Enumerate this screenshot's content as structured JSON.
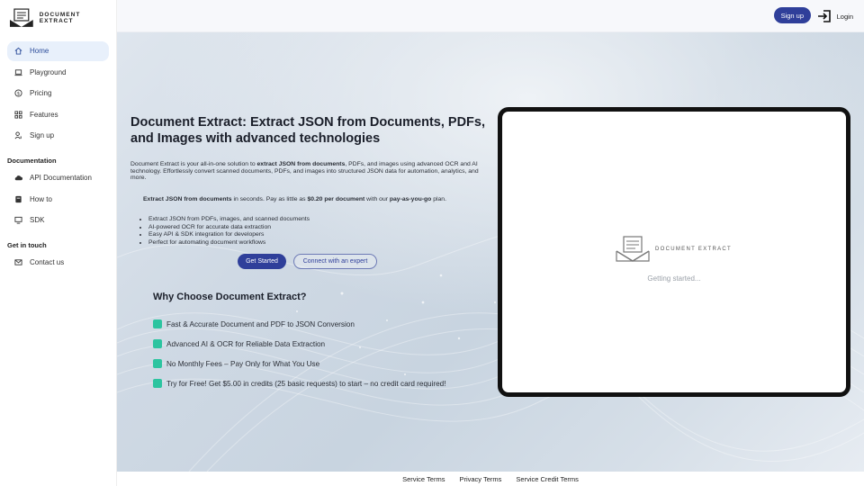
{
  "brand": {
    "name": "DOCUMENT EXTRACT"
  },
  "sidebar": {
    "items": [
      {
        "label": "Home",
        "icon": "home-icon"
      },
      {
        "label": "Playground",
        "icon": "laptop-icon"
      },
      {
        "label": "Pricing",
        "icon": "dollar-icon"
      },
      {
        "label": "Features",
        "icon": "grid-icon"
      },
      {
        "label": "Sign up",
        "icon": "user-add-icon"
      }
    ],
    "documentation": {
      "heading": "Documentation",
      "items": [
        {
          "label": "API Documentation",
          "icon": "cloud-icon"
        },
        {
          "label": "How to",
          "icon": "book-icon"
        },
        {
          "label": "SDK",
          "icon": "monitor-icon"
        }
      ]
    },
    "contact": {
      "heading": "Get in touch",
      "items": [
        {
          "label": "Contact us",
          "icon": "mail-icon"
        }
      ]
    }
  },
  "header": {
    "signup_label": "Sign up",
    "login_label": "Login"
  },
  "hero": {
    "title": "Document Extract: Extract JSON from Documents, PDFs, and Images with advanced technologies",
    "intro_pre": "Document Extract is your all-in-one solution to ",
    "intro_bold": "extract JSON from documents",
    "intro_post": ", PDFs, and images using advanced OCR and AI technology. Effortlessly convert scanned documents, PDFs, and images into structured JSON data for automation, analytics, and more.",
    "price_bold1": "Extract JSON from documents",
    "price_text1": " in seconds. Pay as little as ",
    "price_bold2": "$0.20 per document",
    "price_text2": " with our ",
    "price_bold3": "pay-as-you-go",
    "price_text3": " plan.",
    "bullets": [
      "Extract JSON from PDFs, images, and scanned documents",
      "AI-powered OCR for accurate data extraction",
      "Easy API & SDK integration for developers",
      "Perfect for automating document workflows"
    ],
    "cta_primary": "Get Started",
    "cta_secondary": "Connect with an expert",
    "why_title": "Why Choose Document Extract?",
    "features": [
      "Fast & Accurate Document and PDF to JSON Conversion",
      "Advanced AI & OCR for Reliable Data Extraction",
      "No Monthly Fees – Pay Only for What You Use",
      "Try for Free! Get $5.00 in credits (25 basic requests) to start – no credit card required!"
    ]
  },
  "device": {
    "brand": "DOCUMENT EXTRACT",
    "status": "Getting started..."
  },
  "footer": {
    "links": [
      "Service Terms",
      "Privacy Terms",
      "Service Credit Terms"
    ]
  },
  "colors": {
    "primary": "#2f3f9a",
    "accent": "#2cc4a0",
    "active_bg": "#e8f0fb"
  }
}
